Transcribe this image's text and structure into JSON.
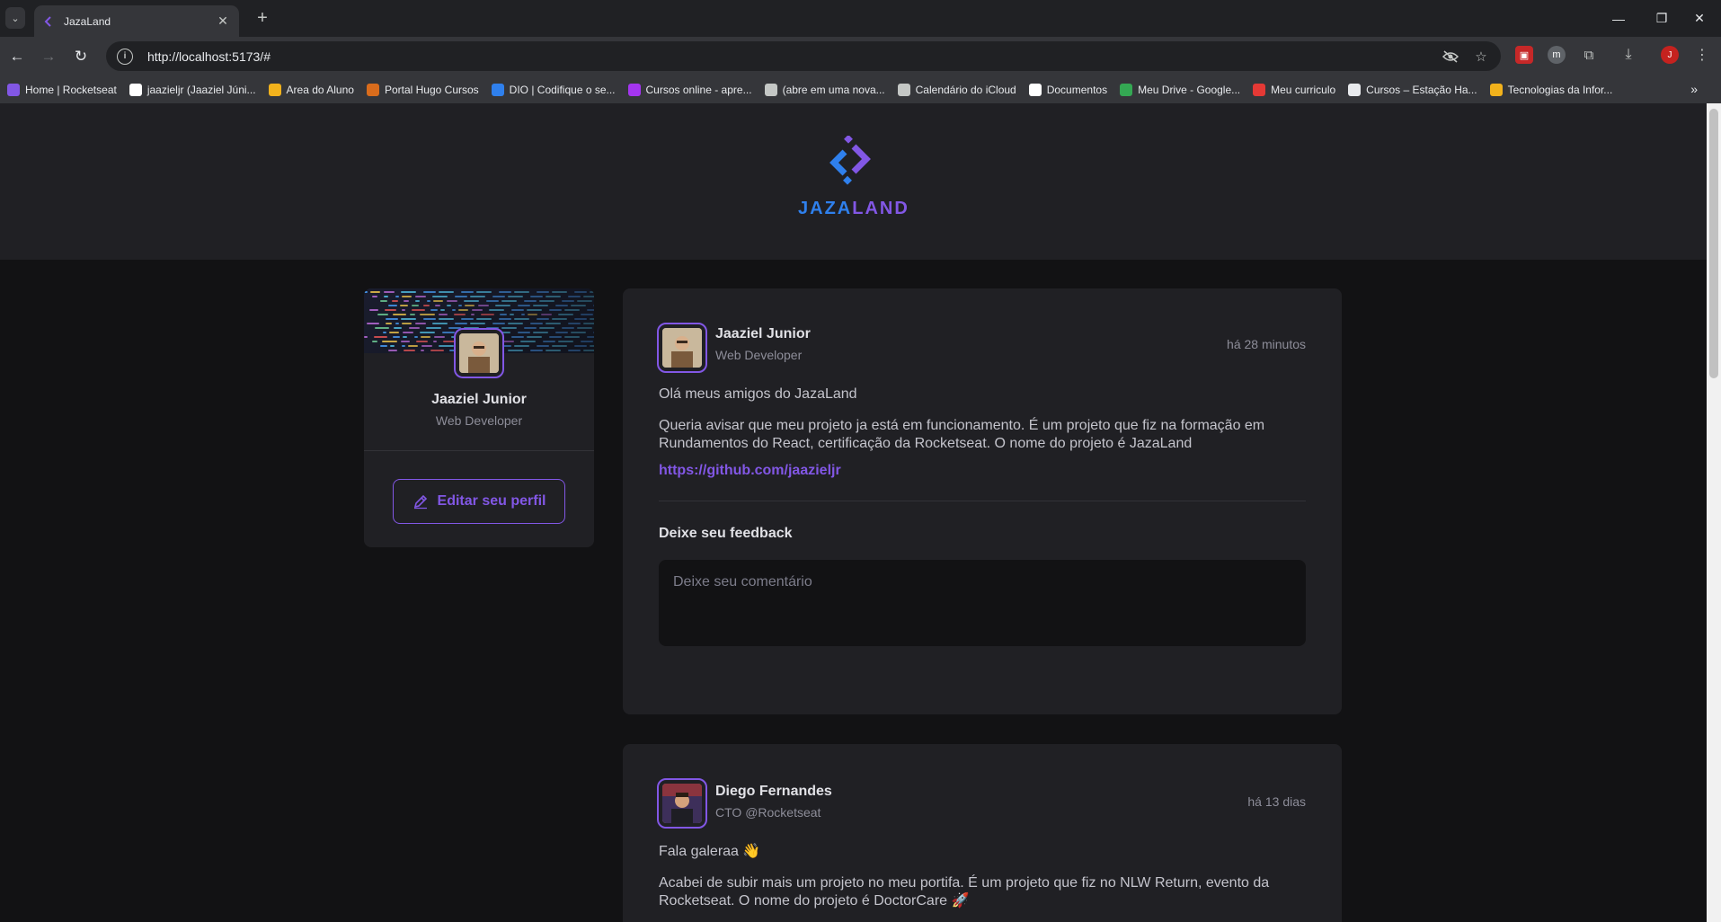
{
  "browser": {
    "tab_title": "JazaLand",
    "url": "http://localhost:5173/#",
    "profile_initial": "J",
    "bookmarks": [
      {
        "label": "Home | Rocketseat",
        "icon": "rocketseat-icon",
        "color": "#8257e5"
      },
      {
        "label": "jaazieljr (Jaaziel Júni...",
        "icon": "github-icon",
        "color": "#ffffff"
      },
      {
        "label": "Area do Aluno",
        "icon": "star-icon",
        "color": "#f2b21c"
      },
      {
        "label": "Portal Hugo Cursos",
        "icon": "hat-icon",
        "color": "#d96c1c"
      },
      {
        "label": "DIO | Codifique o se...",
        "icon": "dio-icon",
        "color": "#2f80ed"
      },
      {
        "label": "Cursos online - apre...",
        "icon": "udemy-icon",
        "color": "#a435f0"
      },
      {
        "label": "(abre em uma nova...",
        "icon": "globe-icon",
        "color": "#c4c7c5"
      },
      {
        "label": "Calendário do iCloud",
        "icon": "apple-icon",
        "color": "#c4c7c5"
      },
      {
        "label": "Documentos",
        "icon": "notion-icon",
        "color": "#ffffff"
      },
      {
        "label": "Meu Drive - Google...",
        "icon": "drive-icon",
        "color": "#34a853"
      },
      {
        "label": "Meu curriculo",
        "icon": "pdf-icon",
        "color": "#e53935"
      },
      {
        "label": "Cursos – Estação Ha...",
        "icon": "page-icon",
        "color": "#e8eaed"
      },
      {
        "label": "Tecnologias da Infor...",
        "icon": "tech-icon",
        "color": "#f2b21c"
      }
    ]
  },
  "logo": {
    "text_part1": "JAZA",
    "text_part2": "LAND",
    "color1": "#2f80ed",
    "color2": "#8257e5"
  },
  "profile": {
    "name": "Jaaziel Junior",
    "role": "Web Developer",
    "edit_label": "Editar seu perfil"
  },
  "posts": [
    {
      "author": "Jaaziel Junior",
      "role": "Web Developer",
      "time": "há 28 minutos",
      "paragraphs": [
        "Olá meus amigos do JazaLand",
        "Queria avisar que meu projeto ja está em funcionamento. É um projeto que fiz na formação em Rundamentos do React, certificação da Rocketseat. O nome do projeto é JazaLand"
      ],
      "link": "https://github.com/jaazieljr",
      "feedback_title": "Deixe seu feedback",
      "comment_placeholder": "Deixe seu comentário"
    },
    {
      "author": "Diego Fernandes",
      "role": "CTO @Rocketseat",
      "time": "há 13 dias",
      "paragraphs": [
        "Fala galeraa 👋",
        "Acabei de subir mais um projeto no meu portifa. É um projeto que fiz no NLW Return, evento da Rocketseat. O nome do projeto é DoctorCare 🚀"
      ]
    }
  ],
  "colors": {
    "accent": "#8257e5",
    "background": "#121214",
    "surface": "#202024"
  }
}
